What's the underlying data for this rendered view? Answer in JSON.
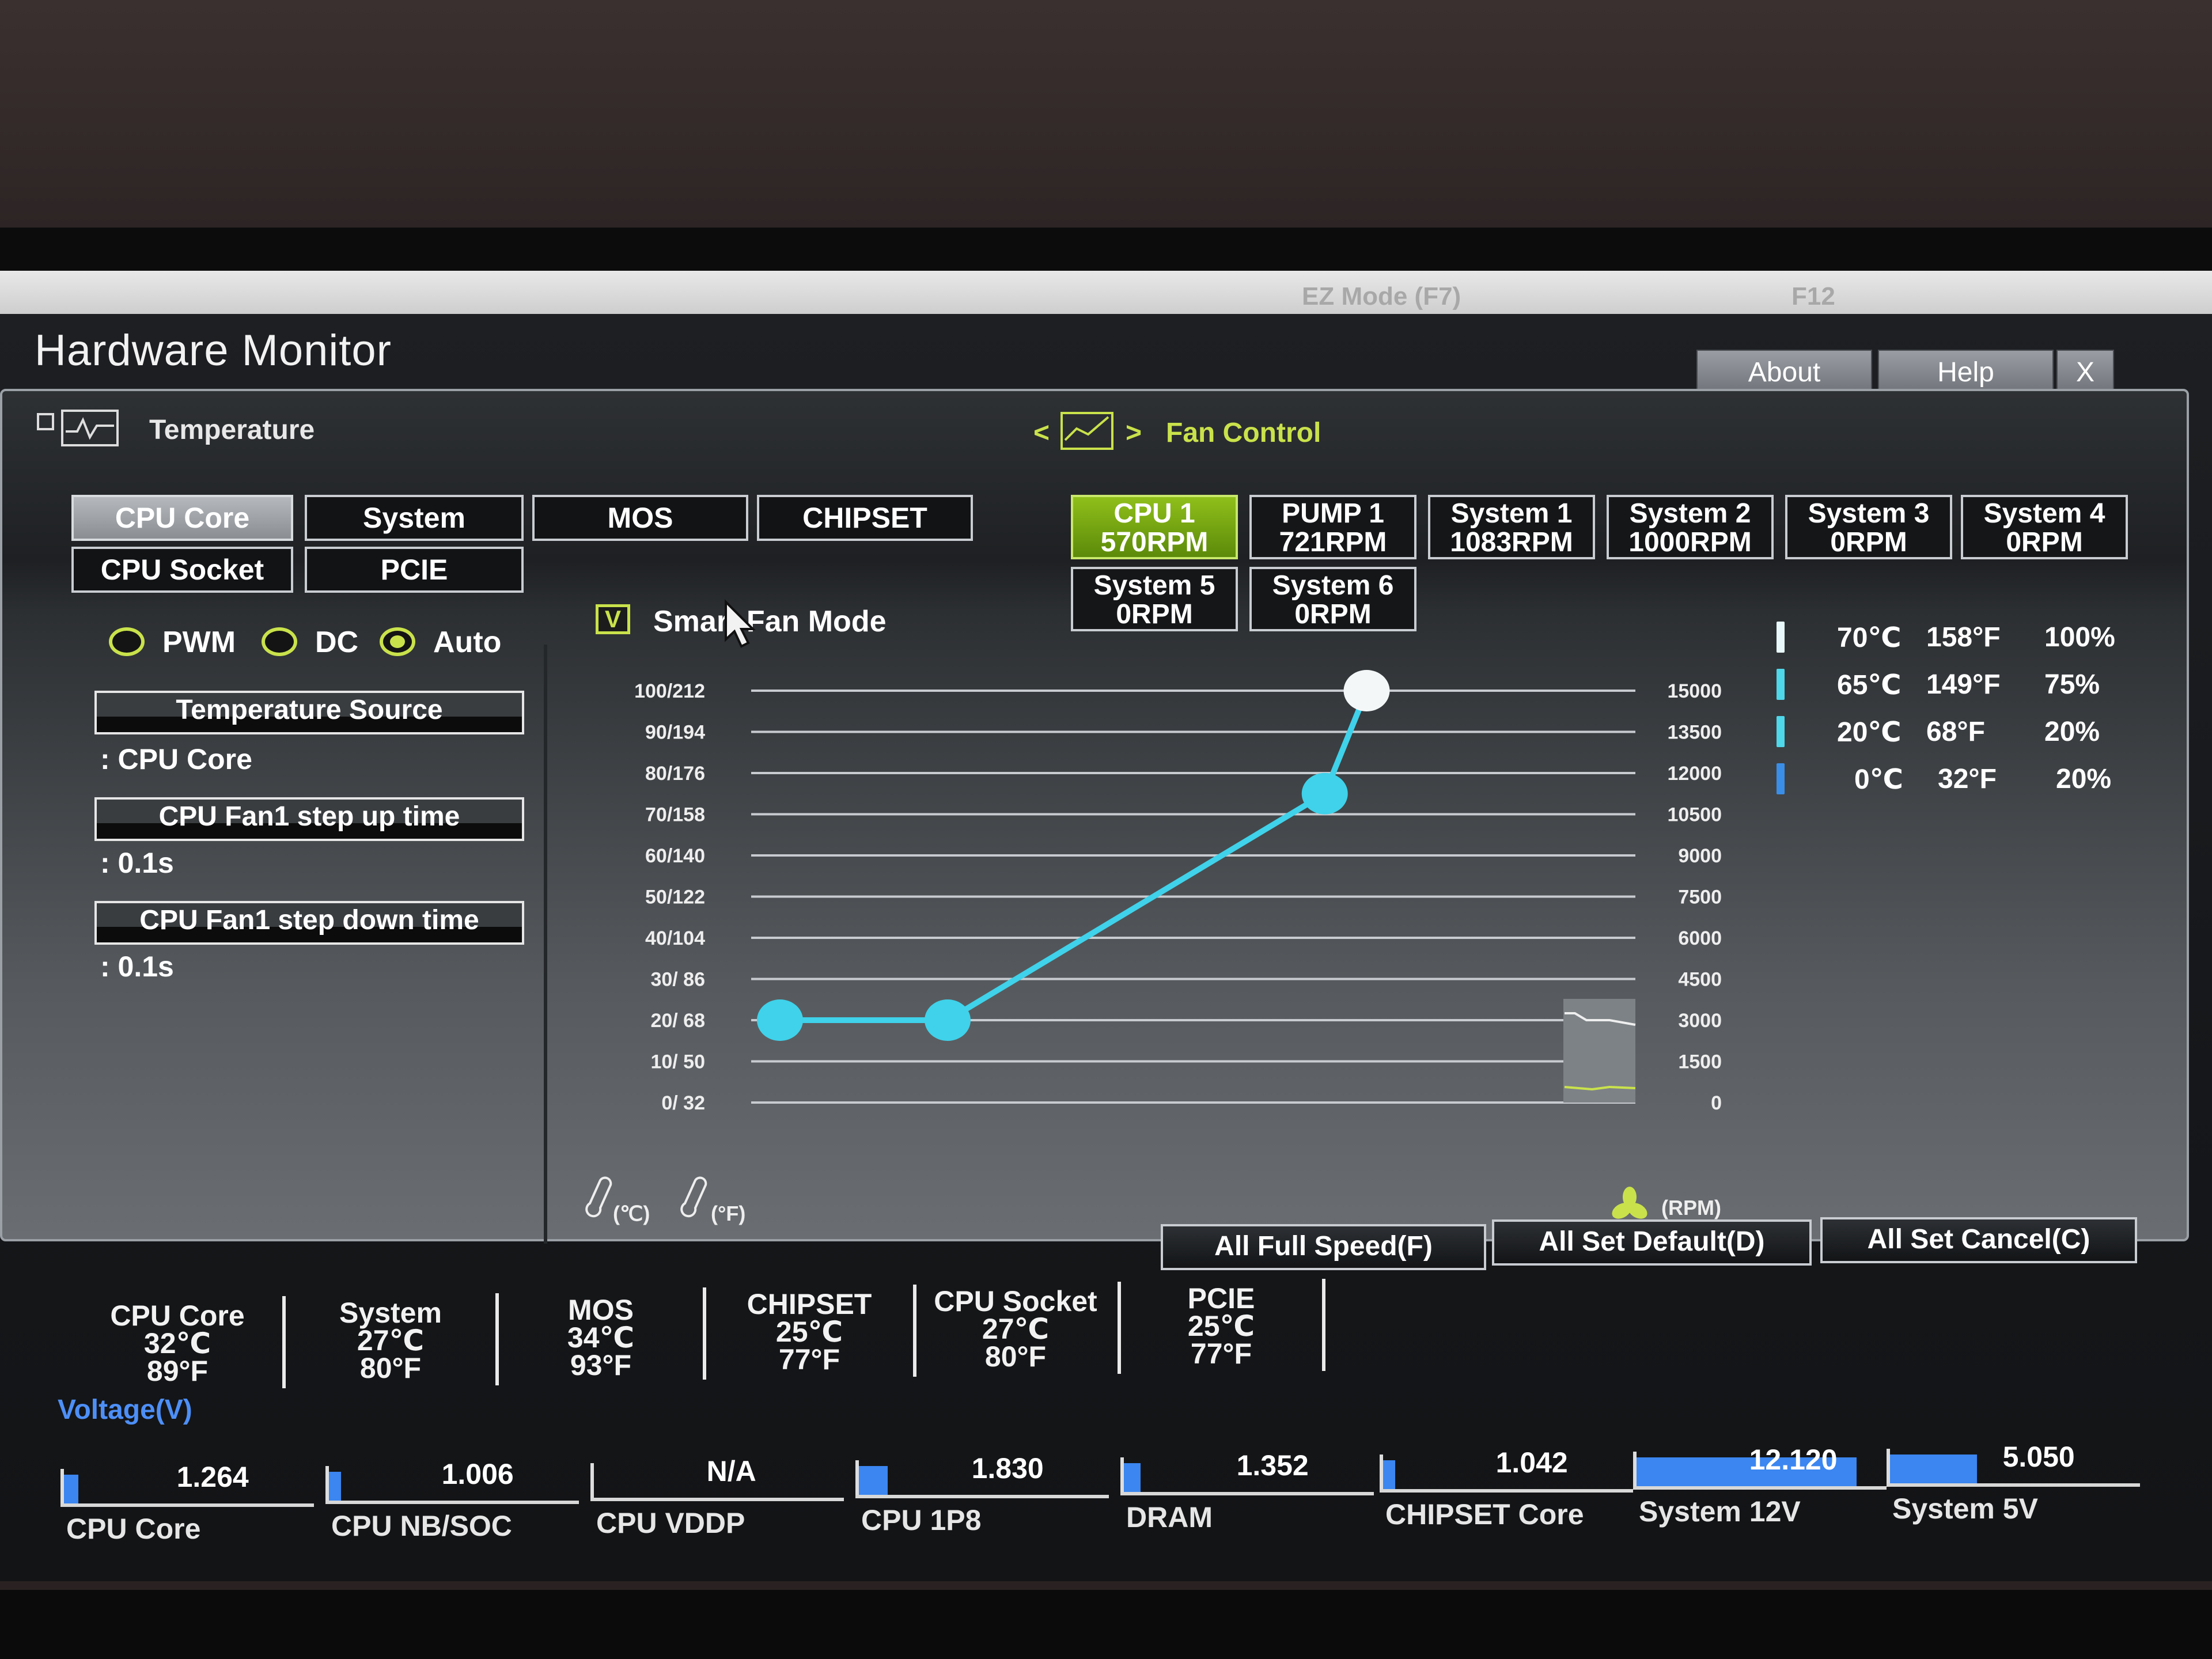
{
  "header_strip": {
    "ez_mode": "EZ Mode (F7)",
    "f12": "F12"
  },
  "window": {
    "title": "Hardware Monitor",
    "buttons": {
      "about": "About",
      "help": "Help",
      "close": "X"
    }
  },
  "temperature": {
    "header": "Temperature",
    "sensors": [
      "CPU Core",
      "System",
      "MOS",
      "CHIPSET",
      "CPU Socket",
      "PCIE"
    ],
    "active": "CPU Core"
  },
  "fan_control": {
    "header": "Fan Control",
    "nav_left": "<",
    "nav_right": ">",
    "fans": [
      {
        "name": "CPU 1",
        "rpm": "570RPM",
        "active": true
      },
      {
        "name": "PUMP 1",
        "rpm": "721RPM"
      },
      {
        "name": "System 1",
        "rpm": "1083RPM"
      },
      {
        "name": "System 2",
        "rpm": "1000RPM"
      },
      {
        "name": "System 3",
        "rpm": "0RPM"
      },
      {
        "name": "System 4",
        "rpm": "0RPM"
      },
      {
        "name": "System 5",
        "rpm": "0RPM"
      },
      {
        "name": "System 6",
        "rpm": "0RPM"
      }
    ]
  },
  "mode": {
    "options": [
      "PWM",
      "DC",
      "Auto"
    ],
    "selected": "Auto",
    "temp_source_label": "Temperature Source",
    "temp_source_value": ": CPU Core",
    "step_up_label": "CPU Fan1 step up time",
    "step_up_value": ": 0.1s",
    "step_down_label": "CPU Fan1 step down time",
    "step_down_value": ": 0.1s"
  },
  "smart_fan": {
    "label": "Smart Fan Mode",
    "checked": true,
    "check_glyph": "V"
  },
  "chart_data": {
    "type": "line",
    "left_ticks": [
      "100/212",
      "90/194",
      "80/176",
      "70/158",
      "60/140",
      "50/122",
      "40/104",
      "30/ 86",
      "20/ 68",
      "10/ 50",
      "0/ 32"
    ],
    "right_ticks": [
      "15000",
      "13500",
      "12000",
      "10500",
      "9000",
      "7500",
      "6000",
      "4500",
      "3000",
      "1500",
      "0"
    ],
    "left_unit_c": "(℃)",
    "left_unit_f": "(°F)",
    "right_unit": "(RPM)",
    "x": [
      0,
      20,
      65,
      70
    ],
    "y_percent": [
      20,
      20,
      75,
      100
    ],
    "ylim": [
      0,
      100
    ],
    "series_color": "#3fd2ea"
  },
  "legend": [
    {
      "c": "70℃",
      "f": "158°F",
      "pct": "100%"
    },
    {
      "c": "65℃",
      "f": "149°F",
      "pct": "75%"
    },
    {
      "c": "20℃",
      "f": "68°F",
      "pct": "20%"
    },
    {
      "c": "0℃",
      "f": "32°F",
      "pct": "20%"
    }
  ],
  "actions": {
    "full_speed": "All Full Speed(F)",
    "set_default": "All Set Default(D)",
    "set_cancel": "All Set Cancel(C)"
  },
  "readouts": [
    {
      "name": "CPU Core",
      "c": "32℃",
      "f": "89°F"
    },
    {
      "name": "System",
      "c": "27℃",
      "f": "80°F"
    },
    {
      "name": "MOS",
      "c": "34℃",
      "f": "93°F"
    },
    {
      "name": "CHIPSET",
      "c": "25℃",
      "f": "77°F"
    },
    {
      "name": "CPU Socket",
      "c": "27℃",
      "f": "80°F"
    },
    {
      "name": "PCIE",
      "c": "25℃",
      "f": "77°F"
    }
  ],
  "voltage": {
    "title": "Voltage(V)",
    "items": [
      {
        "name": "CPU Core",
        "value": "1.264",
        "level": 0.06
      },
      {
        "name": "CPU NB/SOC",
        "value": "1.006",
        "level": 0.05
      },
      {
        "name": "CPU VDDP",
        "value": "N/A",
        "level": 0
      },
      {
        "name": "CPU 1P8",
        "value": "1.830",
        "level": 0.12
      },
      {
        "name": "DRAM",
        "value": "1.352",
        "level": 0.07
      },
      {
        "name": "CHIPSET Core",
        "value": "1.042",
        "level": 0.05
      },
      {
        "name": "System 12V",
        "value": "12.120",
        "level": 0.91
      },
      {
        "name": "System 5V",
        "value": "5.050",
        "level": 0.36
      }
    ]
  }
}
